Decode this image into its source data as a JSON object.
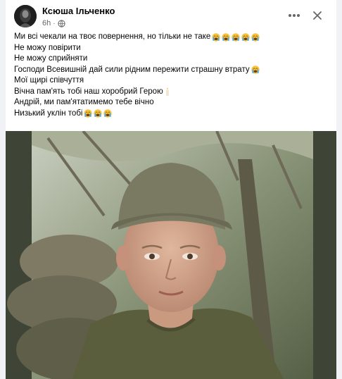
{
  "post": {
    "author": "Ксюша Ільченко",
    "time": "6h",
    "separator": "·",
    "privacy_icon": "globe-icon",
    "more_icon": "more-options-icon",
    "close_icon": "close-icon",
    "lines": {
      "l1": "Ми всі чекали на твоє повернення, но тільки не таке",
      "l2": "Не можу повірити",
      "l3": "Не можу сприйняти",
      "l4": "Господи Всевишній дай сили рідним пережити страшну втрату",
      "l5": "Мої щирі співчуття",
      "l6": "Вічна пам'ять тобі наш хоробрий Герою",
      "l7": "Андрій, ми пам'ятатимемо тебе вічно",
      "l8": "Низький уклін тобі"
    },
    "emoji": {
      "crying_face": "loudly-crying-face-emoji",
      "candle": "candle-emoji"
    }
  },
  "colors": {
    "card_bg": "#ffffff",
    "page_bg": "#f0f2f5",
    "text": "#050505",
    "secondary_text": "#65676b",
    "emoji_yellow": "#f7c33a",
    "emoji_tears": "#4aa3e8",
    "photo_frame": "#3e4536"
  }
}
